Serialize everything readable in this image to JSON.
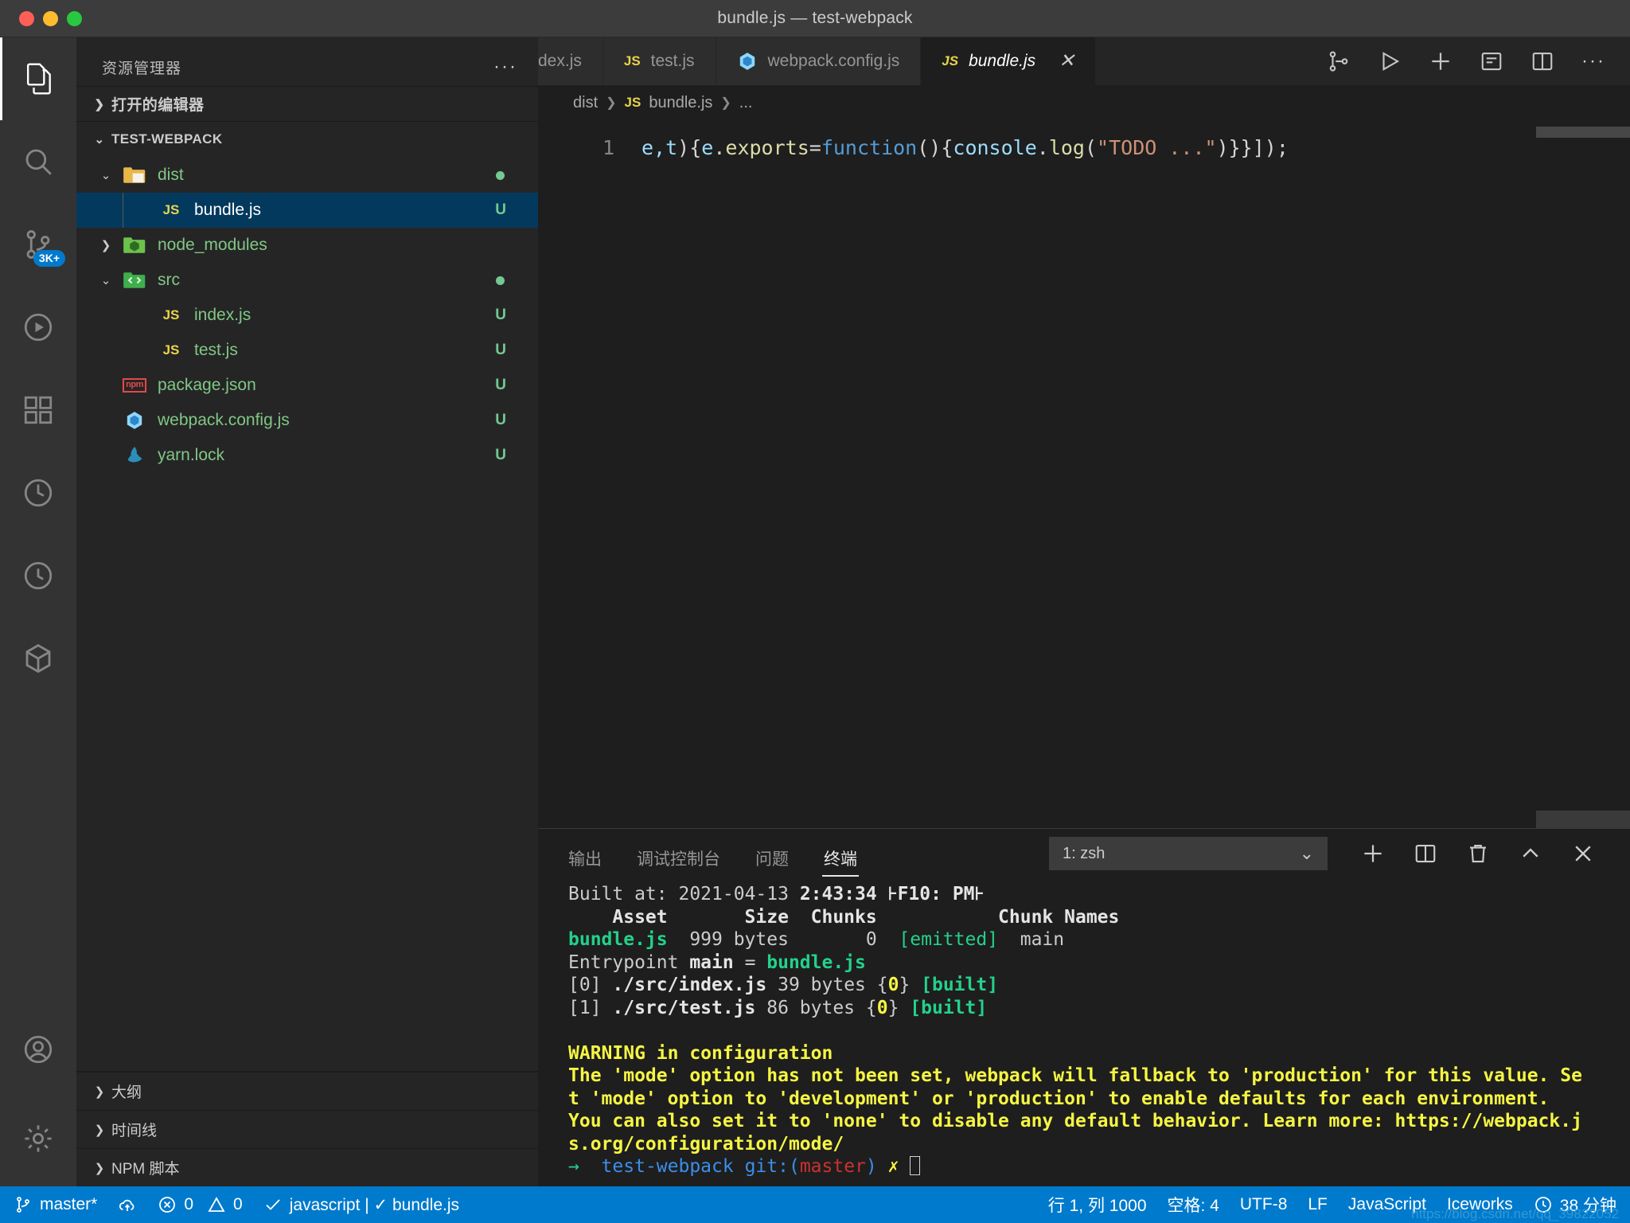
{
  "window": {
    "title": "bundle.js — test-webpack",
    "controls": [
      "close",
      "minimize",
      "maximize"
    ]
  },
  "activity_bar": {
    "items": [
      {
        "name": "explorer",
        "icon": "files-icon",
        "active": true,
        "badge": ""
      },
      {
        "name": "search",
        "icon": "search-icon",
        "active": false,
        "badge": ""
      },
      {
        "name": "source-control",
        "icon": "source-control-icon",
        "active": false,
        "badge": "3K+"
      },
      {
        "name": "run-and-debug",
        "icon": "debug-icon",
        "active": false,
        "badge": ""
      },
      {
        "name": "extensions",
        "icon": "extensions-icon",
        "active": false,
        "badge": ""
      },
      {
        "name": "test-explorer",
        "icon": "beaker-icon",
        "active": false,
        "badge": ""
      },
      {
        "name": "timeline",
        "icon": "clock-icon",
        "active": false,
        "badge": ""
      },
      {
        "name": "iceworks",
        "icon": "cube-icon",
        "active": false,
        "badge": ""
      }
    ],
    "bottom": [
      {
        "name": "accounts",
        "icon": "account-icon"
      },
      {
        "name": "manage",
        "icon": "gear-icon"
      }
    ]
  },
  "sidebar": {
    "header_title": "资源管理器",
    "more_actions": "···",
    "open_editors_label": "打开的编辑器",
    "workspace_label": "TEST-WEBPACK",
    "tree": [
      {
        "label": "dist",
        "kind": "folder-dist",
        "indent": 1,
        "expanded": true,
        "status": "dot",
        "status_text": ""
      },
      {
        "label": "bundle.js",
        "kind": "js",
        "indent": 2,
        "selected": true,
        "status": "U",
        "status_text": "U"
      },
      {
        "label": "node_modules",
        "kind": "folder-node",
        "indent": 1,
        "expanded": false,
        "status": "",
        "status_text": ""
      },
      {
        "label": "src",
        "kind": "folder-src",
        "indent": 1,
        "expanded": true,
        "status": "dot",
        "status_text": ""
      },
      {
        "label": "index.js",
        "kind": "js",
        "indent": 2,
        "status": "U",
        "status_text": "U"
      },
      {
        "label": "test.js",
        "kind": "js",
        "indent": 2,
        "status": "U",
        "status_text": "U"
      },
      {
        "label": "package.json",
        "kind": "npm",
        "indent": 1,
        "status": "U",
        "status_text": "U"
      },
      {
        "label": "webpack.config.js",
        "kind": "webpack",
        "indent": 1,
        "status": "U",
        "status_text": "U"
      },
      {
        "label": "yarn.lock",
        "kind": "yarn",
        "indent": 1,
        "status": "U",
        "status_text": "U"
      }
    ],
    "bottom_sections": [
      {
        "label": "大纲"
      },
      {
        "label": "时间线"
      },
      {
        "label": "NPM 脚本"
      }
    ]
  },
  "editor": {
    "tabs": [
      {
        "label": "dex.js",
        "icon": "js-icon",
        "active": false,
        "partial": true
      },
      {
        "label": "test.js",
        "icon": "js-icon",
        "active": false,
        "partial": false
      },
      {
        "label": "webpack.config.js",
        "icon": "webpack-icon",
        "active": false,
        "partial": false
      },
      {
        "label": "bundle.js",
        "icon": "js-icon",
        "active": true,
        "partial": false,
        "close": "✕"
      }
    ],
    "tab_actions": [
      {
        "name": "open-changes",
        "icon": "compare-icon"
      },
      {
        "name": "run-file",
        "icon": "play-icon"
      },
      {
        "name": "new-file",
        "icon": "plus-icon"
      },
      {
        "name": "open-preview",
        "icon": "preview-icon"
      },
      {
        "name": "split-editor",
        "icon": "split-editor-icon"
      },
      {
        "name": "more-actions",
        "icon": "ellipsis-icon"
      }
    ],
    "breadcrumb": [
      {
        "label": "dist",
        "icon": ""
      },
      {
        "label": "bundle.js",
        "icon": "js-icon"
      },
      {
        "label": "...",
        "icon": ""
      }
    ],
    "line_number": "1",
    "code_tokens": [
      {
        "text": "e,",
        "cls": "tok-var"
      },
      {
        "text": "t",
        "cls": "tok-var"
      },
      {
        "text": "){",
        "cls": "tok-plain"
      },
      {
        "text": "e",
        "cls": "tok-var"
      },
      {
        "text": ".",
        "cls": "tok-plain"
      },
      {
        "text": "exports",
        "cls": "tok-prop"
      },
      {
        "text": "=",
        "cls": "tok-plain"
      },
      {
        "text": "function",
        "cls": "tok-kw"
      },
      {
        "text": "(){",
        "cls": "tok-plain"
      },
      {
        "text": "console",
        "cls": "tok-var"
      },
      {
        "text": ".",
        "cls": "tok-plain"
      },
      {
        "text": "log",
        "cls": "tok-prop"
      },
      {
        "text": "(",
        "cls": "tok-plain"
      },
      {
        "text": "\"TODO ...\"",
        "cls": "tok-str"
      },
      {
        "text": ")}}]);",
        "cls": "tok-plain"
      }
    ]
  },
  "panel": {
    "tabs": [
      {
        "label": "输出",
        "active": false
      },
      {
        "label": "调试控制台",
        "active": false
      },
      {
        "label": "问题",
        "active": false
      },
      {
        "label": "终端",
        "active": true
      }
    ],
    "terminal_select": {
      "value": "1: zsh",
      "chevron": "⌄"
    },
    "actions": [
      {
        "name": "new-terminal",
        "icon": "plus-icon"
      },
      {
        "name": "split-terminal",
        "icon": "split-icon"
      },
      {
        "name": "kill-terminal",
        "icon": "trash-icon"
      },
      {
        "name": "maximize-panel",
        "icon": "chevron-up-icon"
      },
      {
        "name": "close-panel",
        "icon": "close-icon"
      }
    ],
    "terminal_lines": [
      [
        {
          "text": "Built at: ",
          "cls": "t-grey"
        },
        {
          "text": "2021-04-13 ",
          "cls": "t-grey"
        },
        {
          "text": "2:43:34",
          "cls": "t-bold t-white"
        },
        {
          "text": " ",
          "cls": "t-grey"
        },
        {
          "text": "⊦F10: PM⊦",
          "cls": "t-bold t-white"
        }
      ],
      [
        {
          "text": "    Asset       Size  Chunks           Chunk Names",
          "cls": "t-bold t-white"
        }
      ],
      [
        {
          "text": "bundle.js",
          "cls": "t-greenb"
        },
        {
          "text": "  999 bytes       0  ",
          "cls": "t-grey"
        },
        {
          "text": "[emitted]",
          "cls": "t-green"
        },
        {
          "text": "  main",
          "cls": "t-grey"
        }
      ],
      [
        {
          "text": "Entrypoint ",
          "cls": "t-grey"
        },
        {
          "text": "main",
          "cls": "t-bold t-white"
        },
        {
          "text": " = ",
          "cls": "t-grey"
        },
        {
          "text": "bundle.js",
          "cls": "t-greenb"
        }
      ],
      [
        {
          "text": "[0] ",
          "cls": "t-grey"
        },
        {
          "text": "./src/index.js",
          "cls": "t-bold t-white"
        },
        {
          "text": " 39 bytes {",
          "cls": "t-grey"
        },
        {
          "text": "0",
          "cls": "t-yellowb"
        },
        {
          "text": "} ",
          "cls": "t-grey"
        },
        {
          "text": "[built]",
          "cls": "t-greenb"
        }
      ],
      [
        {
          "text": "[1] ",
          "cls": "t-grey"
        },
        {
          "text": "./src/test.js",
          "cls": "t-bold t-white"
        },
        {
          "text": " 86 bytes {",
          "cls": "t-grey"
        },
        {
          "text": "0",
          "cls": "t-yellowb"
        },
        {
          "text": "} ",
          "cls": "t-grey"
        },
        {
          "text": "[built]",
          "cls": "t-greenb"
        }
      ],
      [
        {
          "text": " ",
          "cls": "t-grey"
        }
      ],
      [
        {
          "text": "WARNING in configuration",
          "cls": "t-yellowb"
        }
      ],
      [
        {
          "text": "The 'mode' option has not been set, webpack will fallback to 'production' for this value. Se",
          "cls": "t-yellowb"
        }
      ],
      [
        {
          "text": "t 'mode' option to 'development' or 'production' to enable defaults for each environment.",
          "cls": "t-yellowb"
        }
      ],
      [
        {
          "text": "You can also set it to 'none' to disable any default behavior. Learn more: https://webpack.j",
          "cls": "t-yellowb"
        }
      ],
      [
        {
          "text": "s.org/configuration/mode/",
          "cls": "t-yellowb"
        }
      ],
      [
        {
          "text": "→ ",
          "cls": "t-green"
        },
        {
          "text": " test-webpack ",
          "cls": "t-blue"
        },
        {
          "text": "git:(",
          "cls": "t-blue"
        },
        {
          "text": "master",
          "cls": "t-red"
        },
        {
          "text": ") ",
          "cls": "t-blue"
        },
        {
          "text": "✗ ",
          "cls": "t-yellow"
        }
      ]
    ]
  },
  "status_bar": {
    "left": [
      {
        "name": "branch",
        "icon": "source-control-icon",
        "label": "master*"
      },
      {
        "name": "sync",
        "icon": "cloud-upload-icon",
        "label": ""
      },
      {
        "name": "problems",
        "icon": "error-warning-icon",
        "label": "0  0",
        "errors": "0",
        "warnings": "0"
      },
      {
        "name": "eslint",
        "icon": "check-icon",
        "label": "javascript | ✓ bundle.js"
      }
    ],
    "right": [
      {
        "name": "cursor-position",
        "label": "行 1, 列 1000"
      },
      {
        "name": "indentation",
        "label": "空格: 4"
      },
      {
        "name": "encoding",
        "label": "UTF-8"
      },
      {
        "name": "eol",
        "label": "LF"
      },
      {
        "name": "language-mode",
        "label": "JavaScript"
      },
      {
        "name": "iceworks",
        "label": "Iceworks"
      },
      {
        "name": "time-tracker",
        "icon": "clock-icon",
        "label": "38 分钟"
      }
    ],
    "watermark": "https://blog.csdn.net/qq_39822052"
  },
  "colors": {
    "accent": "#007acc",
    "selection": "#04395e",
    "sidebar_bg": "#252526",
    "editor_bg": "#1e1e1e",
    "activity_bg": "#333333",
    "title_bg": "#3c3c3c",
    "green": "#73c991",
    "yellow": "#f5f543",
    "terminal_green": "#23d18b"
  }
}
